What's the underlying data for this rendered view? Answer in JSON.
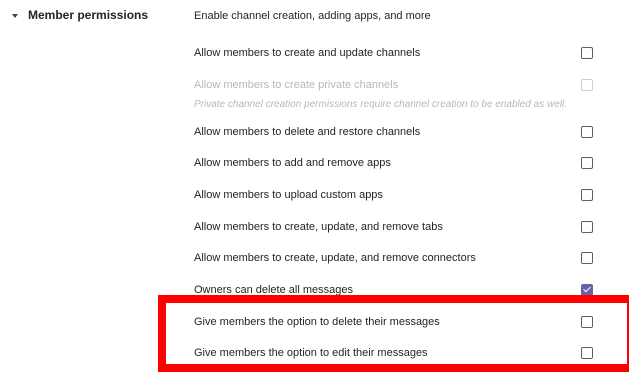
{
  "section": {
    "title": "Member permissions",
    "subtitle": "Enable channel creation, adding apps, and more"
  },
  "note": "Private channel creation permissions require channel creation to be enabled as well.",
  "rows": [
    {
      "label": "Allow members to create and update channels",
      "checked": false,
      "disabled": false
    },
    {
      "label": "Allow members to create private channels",
      "checked": false,
      "disabled": true
    },
    {
      "label": "Allow members to delete and restore channels",
      "checked": false,
      "disabled": false
    },
    {
      "label": "Allow members to add and remove apps",
      "checked": false,
      "disabled": false
    },
    {
      "label": "Allow members to upload custom apps",
      "checked": false,
      "disabled": false
    },
    {
      "label": "Allow members to create, update, and remove tabs",
      "checked": false,
      "disabled": false
    },
    {
      "label": "Allow members to create, update, and remove connectors",
      "checked": false,
      "disabled": false
    },
    {
      "label": "Owners can delete all messages",
      "checked": true,
      "disabled": false
    },
    {
      "label": "Give members the option to delete their messages",
      "checked": false,
      "disabled": false
    },
    {
      "label": "Give members the option to edit their messages",
      "checked": false,
      "disabled": false
    }
  ],
  "colors": {
    "accent": "#6264a7",
    "highlight": "#ff0000"
  }
}
